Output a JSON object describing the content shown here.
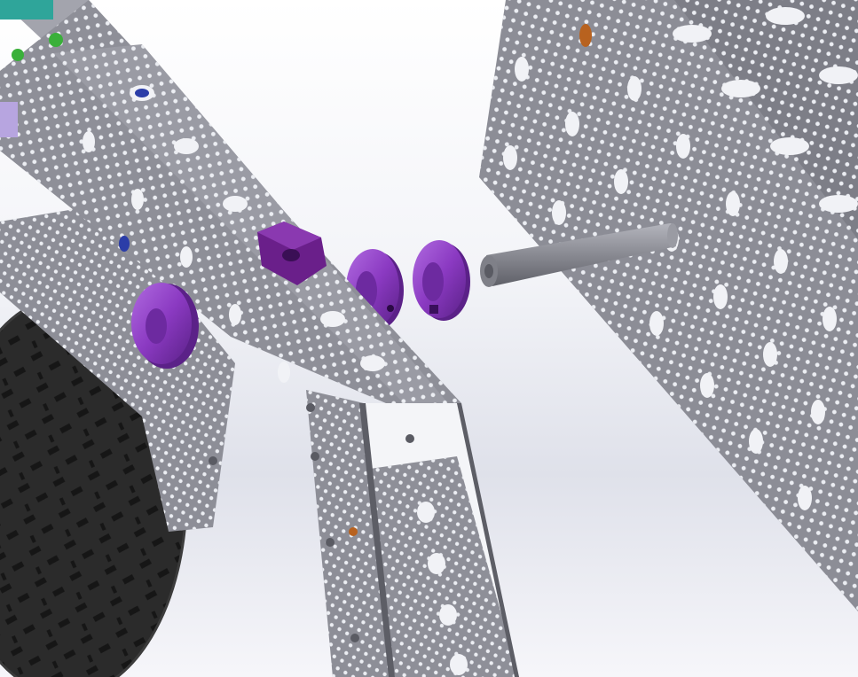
{
  "viewport": {
    "background_top": "#ffffff",
    "background_mid": "#e0e2ea",
    "background_bottom": "#f5f5f9"
  },
  "colors": {
    "metal_face": "#8f9099",
    "metal_light": "#b8b9c2",
    "metal_dark": "#5d5e66",
    "hole": "#eeeff4",
    "collar_purple": "#8e3bc4",
    "collar_dark": "#5a1f86",
    "hub_purple": "#6a1f8a",
    "tire": "#2b2b2b",
    "tread": "#111111",
    "shaft": "#8c8d95",
    "bushing_orange": "#b8621f",
    "teal_part": "#2fa59a",
    "green_part": "#3ab03a",
    "blue_part": "#2b3da8",
    "lilac_part": "#b7a5e0"
  },
  "parts": [
    {
      "name": "tilted-channel-frame"
    },
    {
      "name": "right-channel-frame"
    },
    {
      "name": "vertical-leg-channel"
    },
    {
      "name": "wheel-tire"
    },
    {
      "name": "shaft-collar"
    },
    {
      "name": "clamping-hub"
    },
    {
      "name": "d-shaft"
    },
    {
      "name": "bronze-bushing"
    }
  ]
}
